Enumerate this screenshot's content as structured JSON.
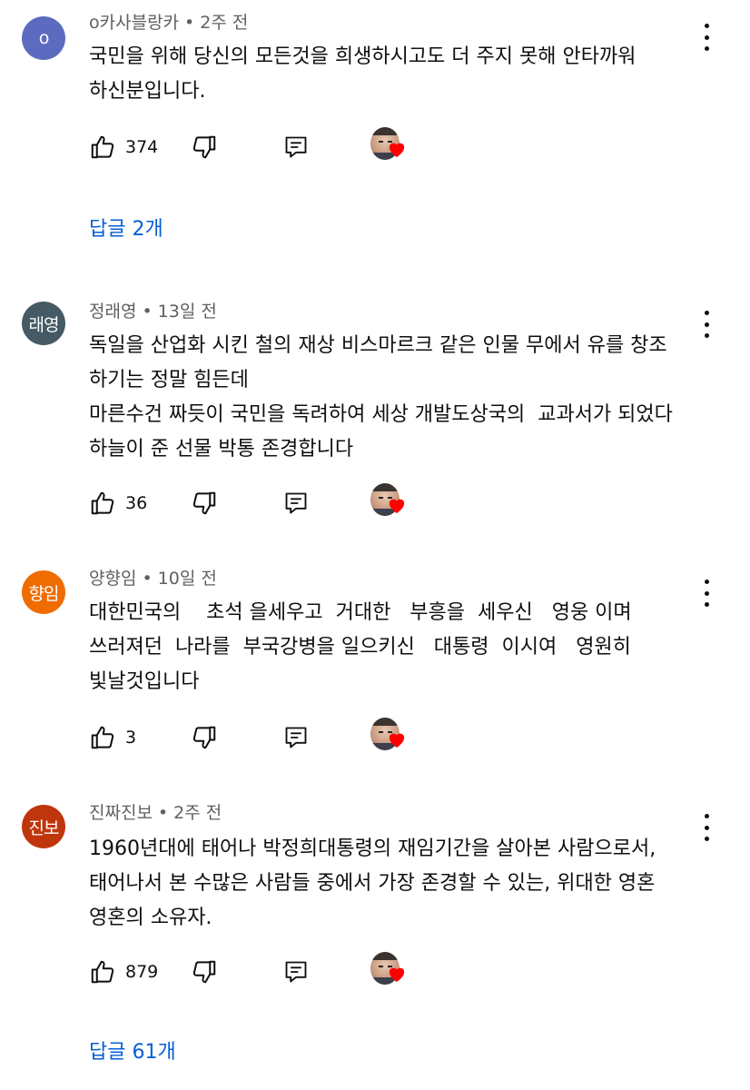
{
  "comments": [
    {
      "author": "o카사블랑카",
      "time": "2주 전",
      "avatar_text": "o",
      "avatar_color": "#5c6bc0",
      "lines": [
        "국민을 위해 당신의 모든것을 희생하시고도 더 주지 못해 안타까워",
        "하신분입니다."
      ],
      "likes": "374",
      "replies": "답글 2개"
    },
    {
      "author": "정래영",
      "time": "13일 전",
      "avatar_text": "래영",
      "avatar_color": "#455a64",
      "lines": [
        "독일을 산업화 시킨 철의 재상 비스마르크 같은 인물 무에서 유를 창조",
        "하기는 정말 힘든데",
        "마른수건 짜듯이 국민을 독려하여 세상 개발도상국의  교과서가 되었다",
        "하늘이 준 선물 박통 존경합니다"
      ],
      "likes": "36",
      "replies": ""
    },
    {
      "author": "양향임",
      "time": "10일 전",
      "avatar_text": "향임",
      "avatar_color": "#ef6c00",
      "lines": [
        "대한민국의    초석 을세우고  거대한   부흥을  세우신   영웅 이며",
        "쓰러져던  나라를  부국강병을 일으키신   대통령  이시여   영원히",
        "빛날것입니다"
      ],
      "likes": "3",
      "replies": ""
    },
    {
      "author": "진짜진보",
      "time": "2주 전",
      "avatar_text": "진보",
      "avatar_color": "#bf360c",
      "lines": [
        "1960년대에 태어나 박정희대통령의 재임기간을 살아본 사람으로서,",
        "태어나서 본 수많은 사람들 중에서 가장 존경할 수 있는, 위대한 영혼",
        "영혼의 소유자."
      ],
      "likes": "879",
      "replies": "답글 61개"
    }
  ],
  "icons": {
    "like": "thumbs-up-icon",
    "dislike": "thumbs-down-icon",
    "reply": "reply-icon",
    "more": "more-vertical-icon",
    "creator_heart": "creator-heart-icon"
  },
  "colors": {
    "link": "#065fd4",
    "meta": "#606060",
    "heart": "#ff0000"
  }
}
